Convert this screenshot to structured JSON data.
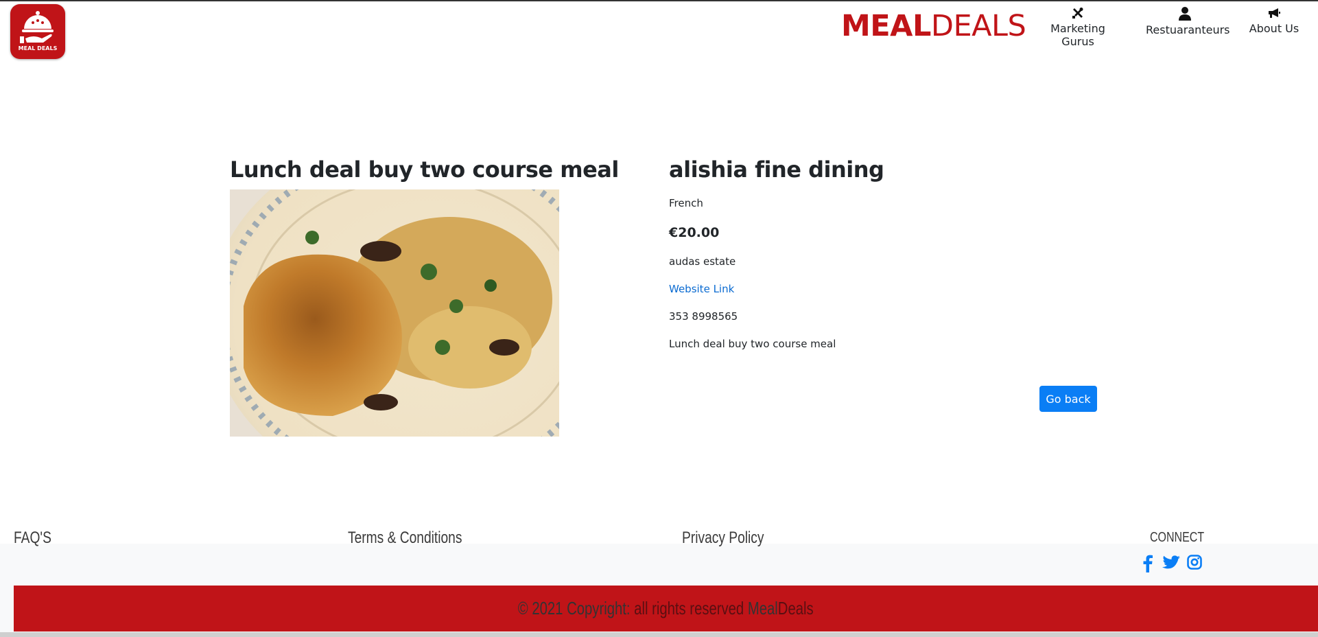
{
  "header": {
    "logo_text": "MEAL DEALS",
    "brand_part1": "MEAL",
    "brand_part2": "DEALS",
    "nav": [
      {
        "label": "Marketing Gurus",
        "icon": "tools-icon"
      },
      {
        "label": "Restuaranteurs",
        "icon": "user-icon"
      },
      {
        "label": "About Us",
        "icon": "megaphone-icon"
      }
    ]
  },
  "deal": {
    "title": "Lunch deal buy two course meal",
    "image_icon": "food-photo"
  },
  "restaurant": {
    "name": "alishia fine dining",
    "cuisine": "French",
    "price": "€20.00",
    "address": "audas estate",
    "website_label": "Website Link",
    "phone": "353 8998565",
    "description": "Lunch deal buy two course meal",
    "go_back_label": "Go back"
  },
  "footer": {
    "faq": "FAQ'S",
    "terms": "Terms & Conditions",
    "privacy": "Privacy Policy",
    "connect": "CONNECT",
    "social_icons": [
      "facebook-icon",
      "twitter-icon",
      "instagram-icon"
    ],
    "copyright_prefix": "© 2021 Copyright: ",
    "copyright_mid": "all rights reserved ",
    "copyright_brand1": "Meal",
    "copyright_brand2": "Deals"
  },
  "colors": {
    "brand_red": "#c01418",
    "link_blue": "#0b6bd1",
    "button_blue": "#0a7ef5"
  }
}
